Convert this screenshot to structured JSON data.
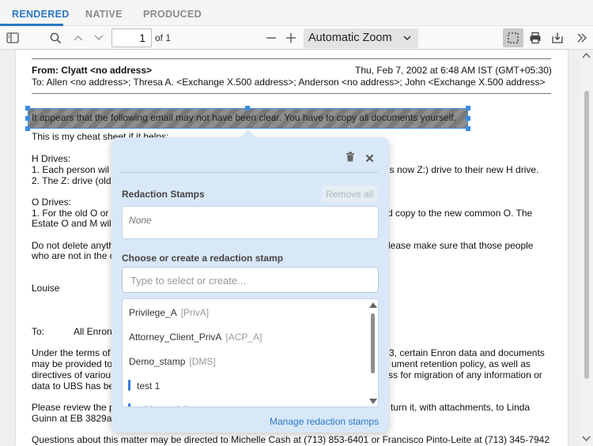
{
  "tabs": [
    {
      "label": "RENDERED"
    },
    {
      "label": "NATIVE"
    },
    {
      "label": "PRODUCED"
    }
  ],
  "toolbar": {
    "page_value": "1",
    "page_of": "of 1",
    "zoom_label": "Automatic Zoom"
  },
  "email": {
    "from": "From: Clyatt <no address>",
    "date": "Thu, Feb 7, 2002 at 6:48 AM IST (GMT+05:30)",
    "to": "To: Allen <no address>; Thresa A. <Exchange X.500 address>; Anderson <no address>; John <Exchange X.500 address>",
    "redacted_line": "It appears that the following email may not have been clear.  You have to copy all documents yourself.",
    "lines": [
      "This is my cheat sheet if it helps:",
      "H Drives:",
      "1.  Each person wil",
      "h is now Z:) drive to their new H drive.",
      "2. The Z: drive (old",
      "O Drives:",
      "1. For the old O or",
      "d copy to the new common O.  The",
      "Estate O and M wil",
      "Do not delete anyth",
      "lease make sure that those people",
      "who are not in the c",
      "Louise",
      "To:",
      "All Enron",
      "Under the terms of",
      "3, certain Enron data and documents",
      "may be provided to",
      "ument retention policy, as well as",
      "directives of variou",
      "ss for migration of any information or",
      "data to UBS has be",
      "Please review the p",
      "turn it, with attachments, to Linda",
      "Guinn at EB 3829a",
      "Questions about this matter may be directed to Michelle Cash at (713) 853-6401 or Francisco Pinto-Leite at (713) 345-7942"
    ]
  },
  "popup": {
    "stamps_label": "Redaction Stamps",
    "remove_all": "Remove all",
    "none_text": "None",
    "choose_label": "Choose or create a redaction stamp",
    "input_placeholder": "Type to select or create...",
    "list": [
      {
        "name": "Privilege_A",
        "code": "[PrivA]"
      },
      {
        "name": "Attorney_Client_PrivA",
        "code": "[ACP_A]"
      },
      {
        "name": "Demo_stamp",
        "code": "[DMS]"
      },
      {
        "name": "test 1",
        "code": ""
      },
      {
        "name": "wiki_not_full",
        "code": ""
      }
    ],
    "manage_link": "Manage redaction stamps"
  },
  "colors": {
    "accent": "#2b78c5",
    "popup_bg": "#d9e8f8"
  }
}
